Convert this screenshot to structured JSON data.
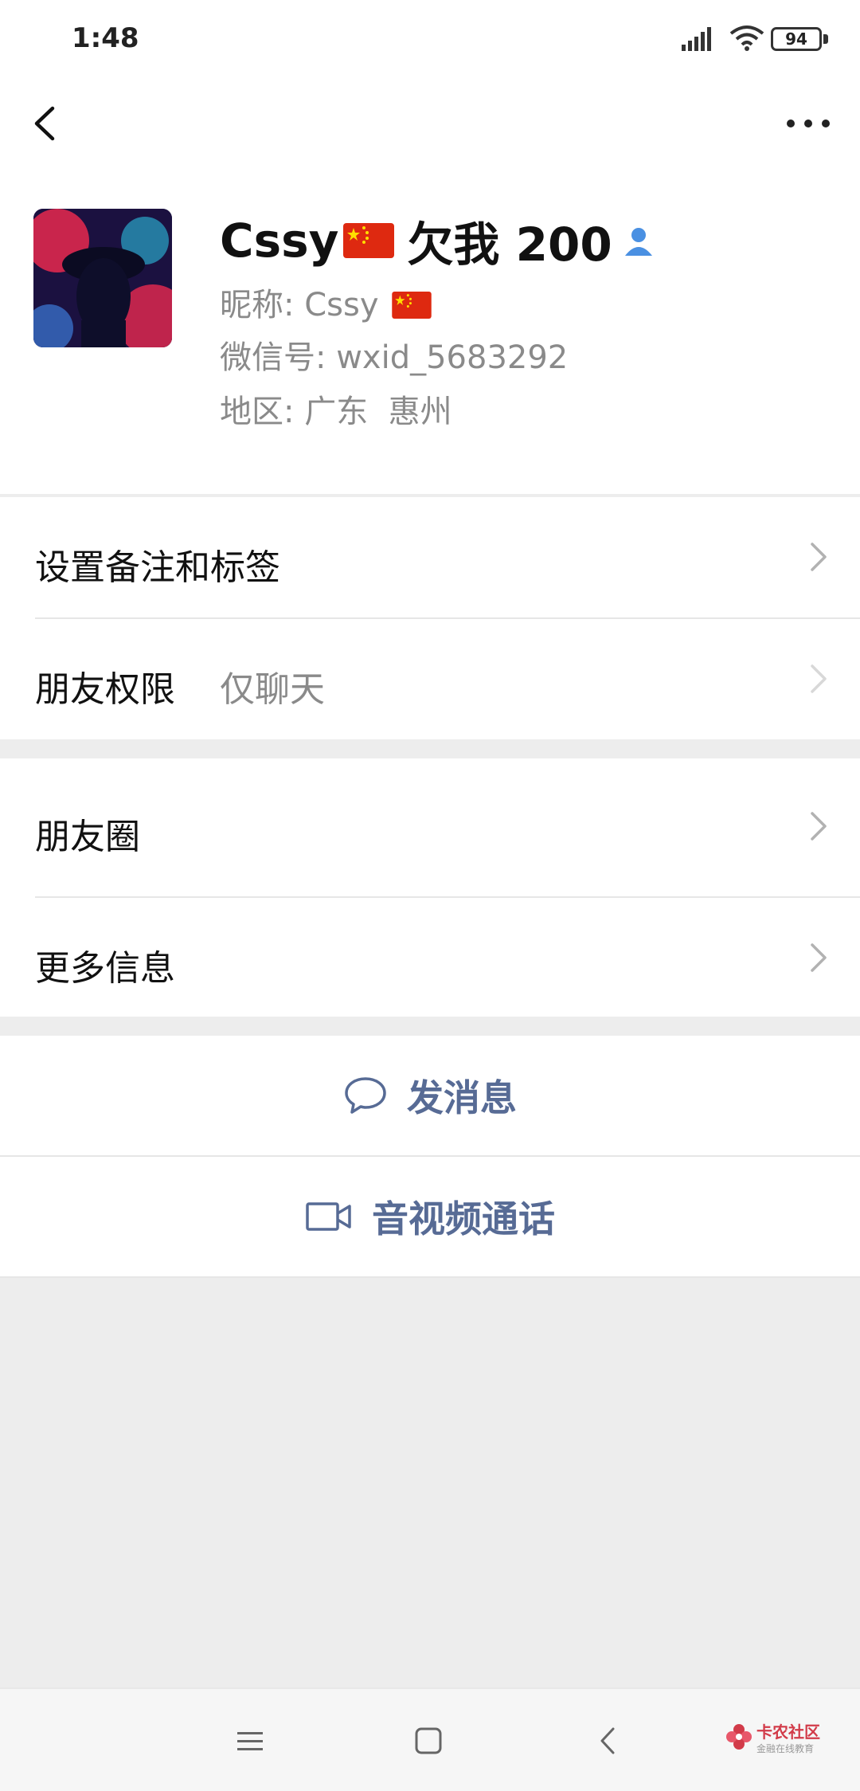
{
  "status_bar": {
    "time": "1:48",
    "battery": "94"
  },
  "profile": {
    "display_name": "Cssy",
    "display_name_suffix": "欠我 200",
    "nickname_label": "昵称:",
    "nickname": "Cssy",
    "wechat_id_label": "微信号:",
    "wechat_id": "wxid_5683292",
    "region_label": "地区:",
    "region": "广东  惠州"
  },
  "menu": {
    "set_remark": "设置备注和标签",
    "friend_permission": "朋友权限",
    "friend_permission_value": "仅聊天",
    "moments": "朋友圈",
    "more_info": "更多信息"
  },
  "actions": {
    "send_message": "发消息",
    "video_call": "音视频通话"
  },
  "watermark": {
    "title": "卡农社区",
    "subtitle": "金融在线教育"
  },
  "colors": {
    "link": "#576b95",
    "background": "#ededed",
    "verified": "#4a90e2"
  },
  "icons": [
    "back-icon",
    "more-icon",
    "person-verified-icon",
    "chevron-right-icon",
    "chat-bubble-icon",
    "video-camera-icon",
    "menu-icon",
    "home-icon",
    "nav-back-icon"
  ]
}
